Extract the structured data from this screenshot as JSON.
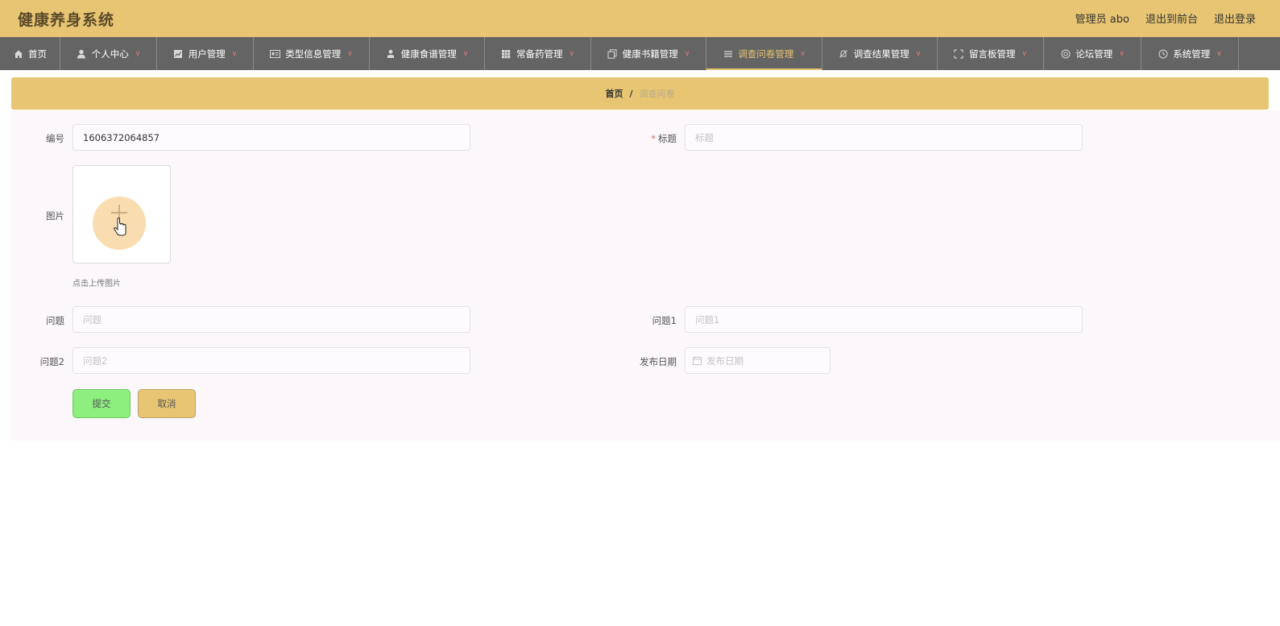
{
  "header": {
    "title": "健康养身系统",
    "admin_label": "管理员 abo",
    "exit_front_label": "退出到前台",
    "logout_label": "退出登录"
  },
  "nav": {
    "items": [
      {
        "label": "首页",
        "icon": "home-icon",
        "chevron": false,
        "active": false
      },
      {
        "label": "个人中心",
        "icon": "user-icon",
        "chevron": true,
        "active": false
      },
      {
        "label": "用户管理",
        "icon": "chart-icon",
        "chevron": true,
        "active": false
      },
      {
        "label": "类型信息管理",
        "icon": "id-card-icon",
        "chevron": true,
        "active": false
      },
      {
        "label": "健康食谱管理",
        "icon": "person-icon",
        "chevron": true,
        "active": false
      },
      {
        "label": "常备药管理",
        "icon": "grid-icon",
        "chevron": true,
        "active": false
      },
      {
        "label": "健康书籍管理",
        "icon": "copy-icon",
        "chevron": true,
        "active": false
      },
      {
        "label": "调查问卷管理",
        "icon": "list-icon",
        "chevron": true,
        "active": true
      },
      {
        "label": "调查结果管理",
        "icon": "bell-off-icon",
        "chevron": true,
        "active": false
      },
      {
        "label": "留言板管理",
        "icon": "fullscreen-icon",
        "chevron": true,
        "active": false
      },
      {
        "label": "论坛管理",
        "icon": "support-icon",
        "chevron": true,
        "active": false
      },
      {
        "label": "系统管理",
        "icon": "clock-icon",
        "chevron": true,
        "active": false
      }
    ]
  },
  "breadcrumb": {
    "home": "首页",
    "separator": "/",
    "current": "调查问卷"
  },
  "form": {
    "number_label": "编号",
    "number_value": "1606372064857",
    "title_label": "标题",
    "title_placeholder": "标题",
    "image_label": "图片",
    "upload_hint": "点击上传图片",
    "question_label": "问题",
    "question_placeholder": "问题",
    "question1_label": "问题1",
    "question1_placeholder": "问题1",
    "question2_label": "问题2",
    "question2_placeholder": "问题2",
    "date_label": "发布日期",
    "date_placeholder": "发布日期",
    "submit_label": "提交",
    "cancel_label": "取消"
  },
  "colors": {
    "accent": "#e8c572",
    "nav_bg": "#646464",
    "submit_bg": "#8cef7e"
  }
}
